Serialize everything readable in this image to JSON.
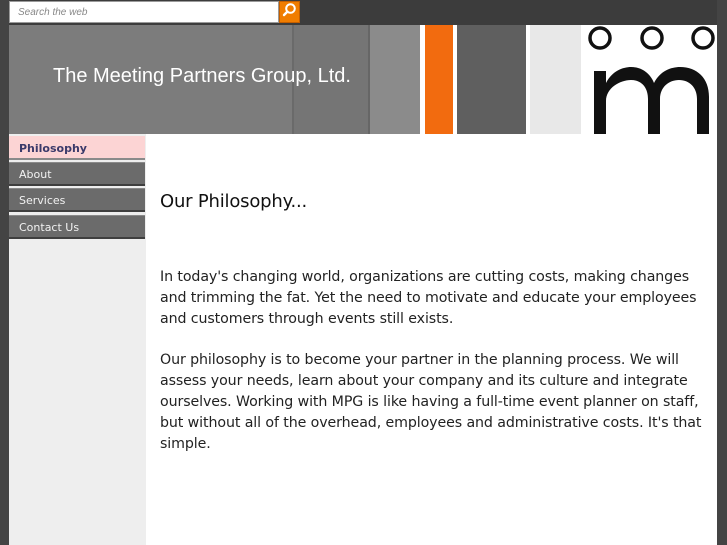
{
  "search": {
    "placeholder": "Search the web"
  },
  "header": {
    "title": "The Meeting Partners Group, Ltd.",
    "accent_color": "#f26b0f"
  },
  "nav": {
    "items": [
      {
        "label": "Philosophy",
        "active": true
      },
      {
        "label": "About",
        "active": false
      },
      {
        "label": "Services",
        "active": false
      },
      {
        "label": "Contact Us",
        "active": false
      }
    ]
  },
  "main": {
    "heading": "Our Philosophy...",
    "paragraphs": [
      "In today's changing world, organizations are cutting costs, making changes and trimming the fat. Yet the need to motivate and educate your employees and customers through events still exists.",
      "Our philosophy is to become your partner in the planning process. We will assess your needs, learn about your company and its culture and integrate ourselves. Working with MPG is like having a full-time event planner on staff, but without all of the overhead, employees and administrative costs. It's that simple."
    ]
  }
}
